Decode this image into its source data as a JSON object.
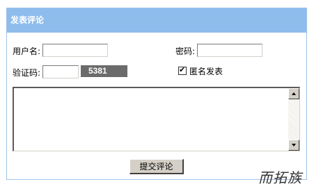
{
  "header": {
    "title": "发表评论"
  },
  "form": {
    "username_label": "用户名:",
    "username_value": "",
    "password_label": "密码:",
    "password_value": "",
    "captcha_label": "验证码:",
    "captcha_value": "",
    "captcha_code": "5381",
    "anonymous_label": "匿名发表",
    "anonymous_checked": true,
    "comment_value": "",
    "submit_label": "提交评论"
  },
  "watermark": "而拓族"
}
